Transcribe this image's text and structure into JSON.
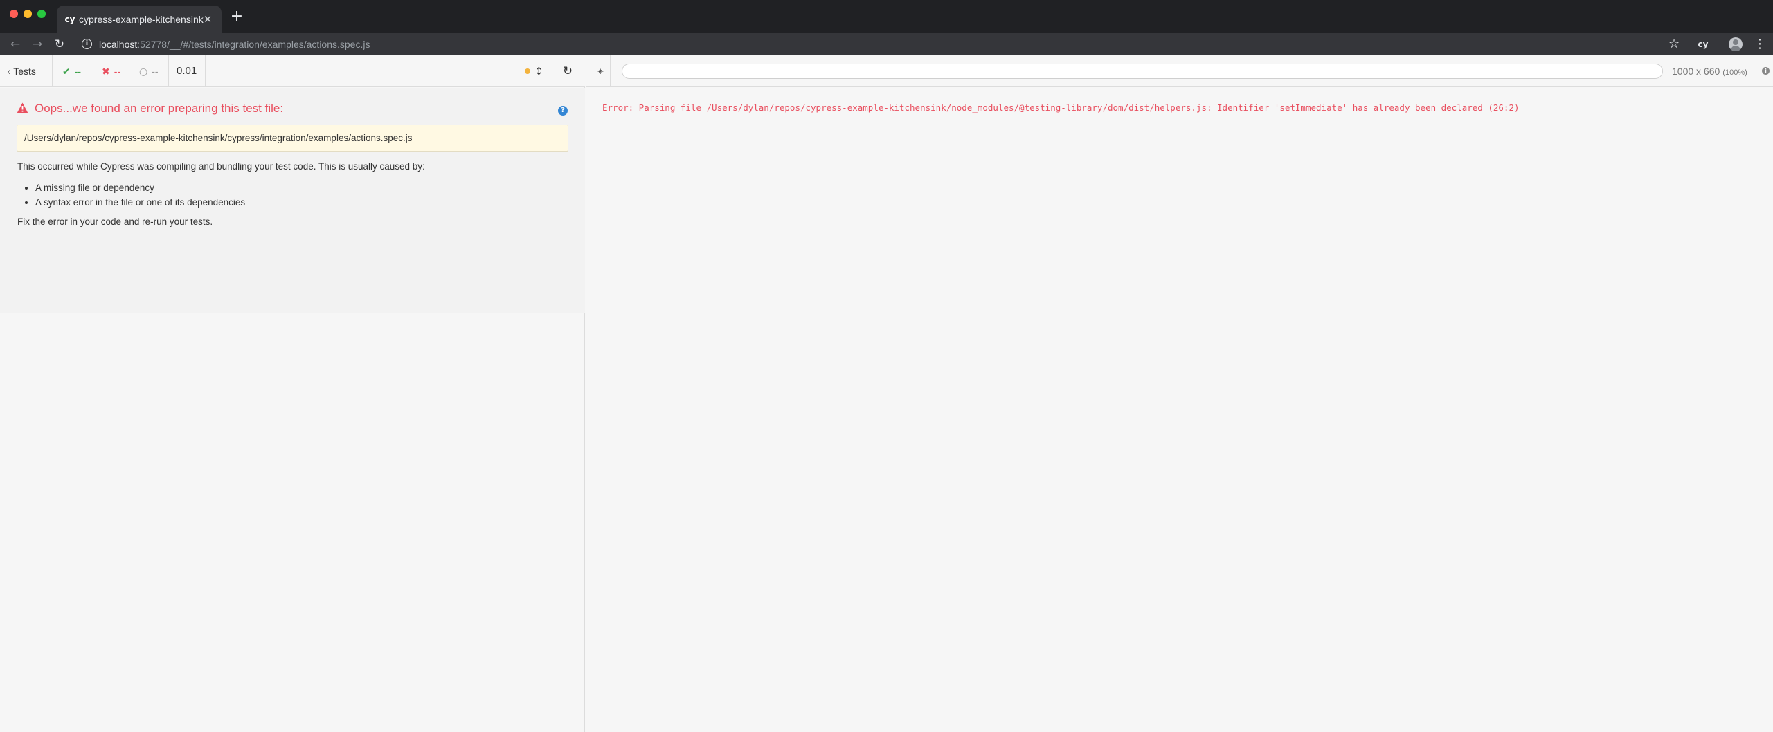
{
  "browser": {
    "tab_title": "cypress-example-kitchensink",
    "tab_favicon": "cy",
    "url_host": "localhost",
    "url_rest": ":52778/__/#/tests/integration/examples/actions.spec.js",
    "extension_label": "cy"
  },
  "reporter": {
    "tests_label": "Tests",
    "passed": "--",
    "failed": "--",
    "pending": "--",
    "duration": "0.01",
    "auto_scroll_color": "#f3b33d"
  },
  "error": {
    "title": "Oops...we found an error preparing this test file:",
    "file_path": "/Users/dylan/repos/cypress-example-kitchensink/cypress/integration/examples/actions.spec.js",
    "description": "This occurred while Cypress was compiling and bundling your test code. This is usually caused by:",
    "causes": [
      "A missing file or dependency",
      "A syntax error in the file or one of its dependencies"
    ],
    "fix": "Fix the error in your code and re-run your tests.",
    "color": "#e94f5f"
  },
  "aut": {
    "viewport_size": "1000 x 660",
    "viewport_scale": "(100%)",
    "error_message": "Error: Parsing file /Users/dylan/repos/cypress-example-kitchensink/node_modules/@testing-library/dom/dist/helpers.js: Identifier 'setImmediate' has already been declared (26:2)"
  }
}
